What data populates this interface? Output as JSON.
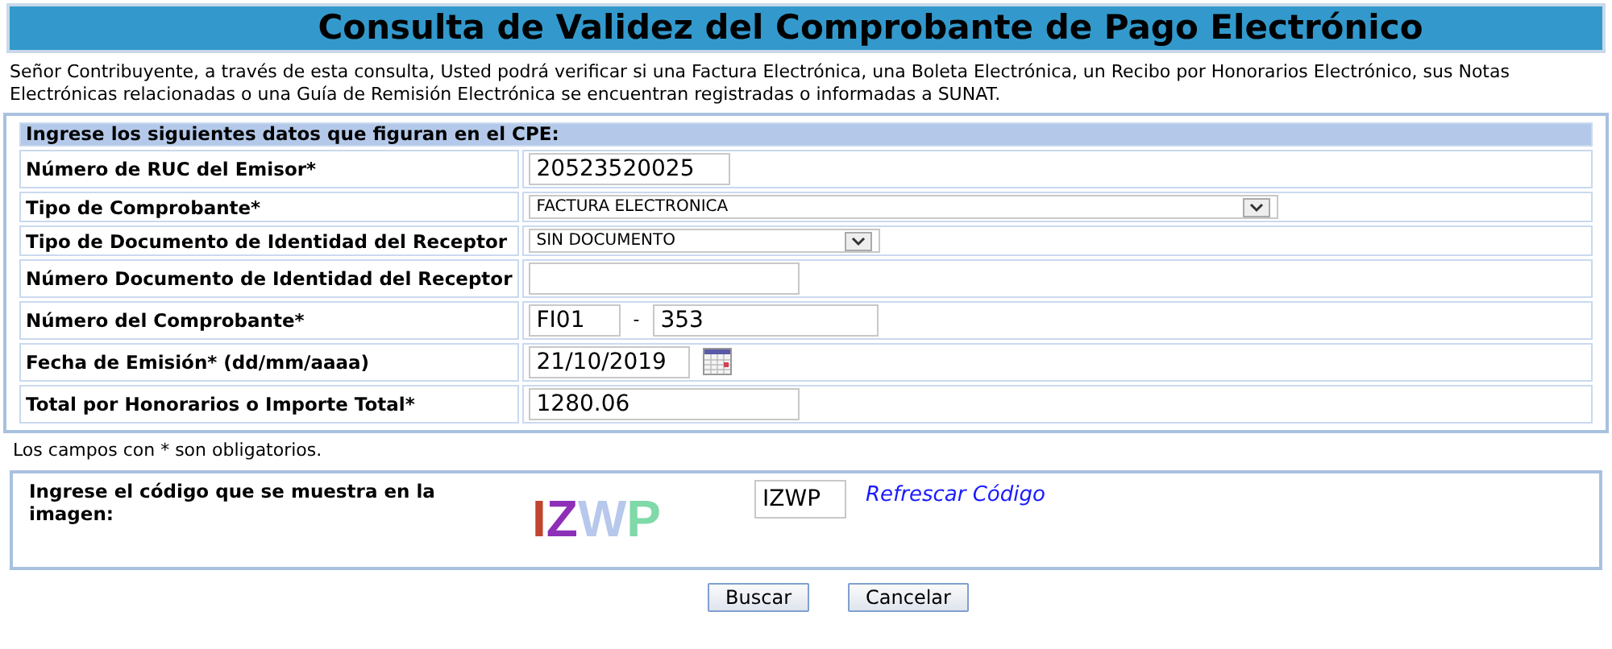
{
  "title": "Consulta de Validez del Comprobante de Pago Electrónico",
  "intro": "Señor Contribuyente, a través de esta consulta, Usted podrá verificar si una Factura Electrónica, una Boleta Electrónica, un Recibo por Honorarios Electrónico, sus Notas Electrónicas relacionadas o una Guía de Remisión Electrónica se encuentran registradas o informadas a SUNAT.",
  "form": {
    "header": "Ingrese los siguientes datos que figuran en el CPE:",
    "fields": [
      {
        "kind": "text",
        "label": "Número de RUC del Emisor*",
        "value": "20523520025"
      },
      {
        "kind": "select",
        "label": "Tipo de Comprobante*",
        "value": "FACTURA ELECTRONICA"
      },
      {
        "kind": "select",
        "label": "Tipo de Documento de Identidad del Receptor",
        "value": "SIN DOCUMENTO"
      },
      {
        "kind": "text",
        "label": "Número Documento de Identidad del Receptor"
      },
      {
        "kind": "pair",
        "label": "Número del Comprobante*",
        "value": "FI01",
        "separator": "-",
        "value2": "353"
      },
      {
        "kind": "date",
        "label": "Fecha de Emisión* (dd/mm/aaaa)",
        "value": "21/10/2019"
      },
      {
        "kind": "text",
        "label": "Total por Honorarios o Importe Total*",
        "value": "1280.06"
      }
    ]
  },
  "note": "Los campos con * son obligatorios.",
  "captcha": {
    "prompt": "Ingrese el código que se muestra en la imagen:",
    "letters": [
      {
        "char": "I",
        "color": "#c0452f"
      },
      {
        "char": "Z",
        "color": "#8e2fb8"
      },
      {
        "char": "W",
        "color": "#b7c8ec"
      },
      {
        "char": "P",
        "color": "#7fd9a8"
      }
    ],
    "value": "IZWP",
    "refresh_link": "Refrescar Código"
  },
  "buttons": [
    "Buscar",
    "Cancelar"
  ]
}
